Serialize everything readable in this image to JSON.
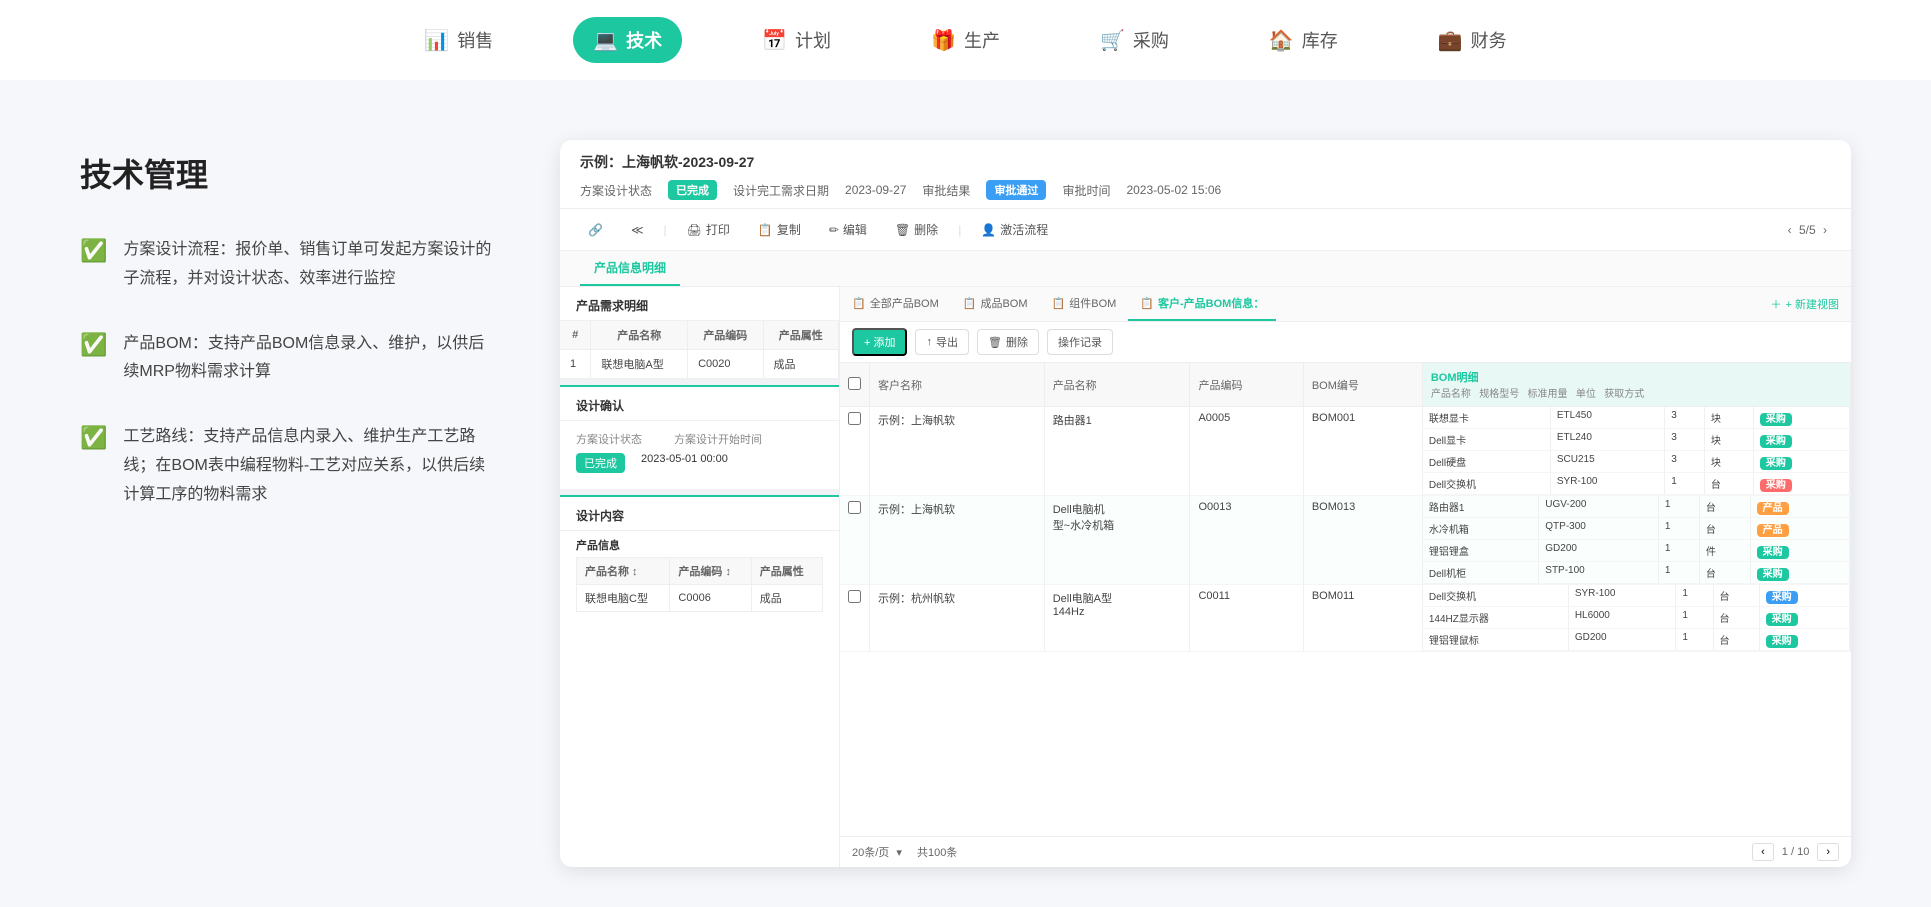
{
  "nav": {
    "items": [
      {
        "id": "sales",
        "label": "销售",
        "icon": "📊",
        "active": false
      },
      {
        "id": "tech",
        "label": "技术",
        "icon": "💻",
        "active": true
      },
      {
        "id": "plan",
        "label": "计划",
        "icon": "📅",
        "active": false
      },
      {
        "id": "produce",
        "label": "生产",
        "icon": "🎁",
        "active": false
      },
      {
        "id": "purchase",
        "label": "采购",
        "icon": "🛒",
        "active": false
      },
      {
        "id": "stock",
        "label": "库存",
        "icon": "🏠",
        "active": false
      },
      {
        "id": "finance",
        "label": "财务",
        "icon": "💼",
        "active": false
      }
    ]
  },
  "left": {
    "title": "技术管理",
    "features": [
      {
        "id": "f1",
        "text": "方案设计流程：报价单、销售订单可发起方案设计的子流程，并对设计状态、效率进行监控"
      },
      {
        "id": "f2",
        "text": "产品BOM：支持产品BOM信息录入、维护，以供后续MRP物料需求计算"
      },
      {
        "id": "f3",
        "text": "工艺路线：支持产品信息内录入、维护生产工艺路线；在BOM表中编程物料-工艺对应关系，以供后续计算工序的物料需求"
      }
    ]
  },
  "demo": {
    "title": "示例：上海帆软-2023-09-27",
    "meta": {
      "status_label": "方案设计状态",
      "status_value": "已完成",
      "design_date_label": "设计完工需求日期",
      "design_date_value": "2023-09-27",
      "approve_result_label": "审批结果",
      "approve_result_value": "审批通过",
      "approve_time_label": "审批时间",
      "approve_time_value": "2023-05-02 15:06"
    },
    "toolbar": {
      "print": "打印",
      "copy": "复制",
      "edit": "编辑",
      "delete": "删除",
      "activate": "激活流程",
      "pagination": "5/5"
    },
    "tabs": {
      "active": "产品信息明细"
    },
    "left_form": {
      "product_demand_title": "产品需求明细",
      "product_demand_cols": [
        "产品名称",
        "产品编码",
        "产品属性"
      ],
      "product_demand_rows": [
        {
          "no": "1",
          "name": "联想电脑A型",
          "code": "C0020",
          "attr": "成品"
        }
      ],
      "design_confirm_title": "设计确认",
      "design_status_label": "方案设计状态",
      "design_start_label": "方案设计开始时间",
      "design_status_value": "已完成",
      "design_start_value": "2023-05-01 00:00",
      "design_content_title": "设计内容",
      "product_info_title": "产品信息",
      "product_info_label": "产品信息",
      "product_table_cols": [
        "产品名称",
        "产品编码",
        "产品属性"
      ],
      "product_table_rows": [
        {
          "name": "联想电脑C型",
          "code": "C0006",
          "attr": "成品"
        }
      ]
    },
    "bom": {
      "tabs": [
        {
          "id": "all",
          "label": "全部产品BOM",
          "icon": "📋",
          "active": false
        },
        {
          "id": "finished",
          "label": "成品BOM",
          "icon": "📋",
          "active": false
        },
        {
          "id": "component",
          "label": "组件BOM",
          "icon": "📋",
          "active": false
        },
        {
          "id": "customer",
          "label": "客户-产品BOM信息：",
          "icon": "📋",
          "active": true
        }
      ],
      "add_tab": "+ 新建视图",
      "toolbar": {
        "add": "+ 添加",
        "export": "↑ 导出",
        "delete": "删除",
        "log": "操作记录"
      },
      "cols": [
        "客户名称",
        "产品名称",
        "产品编码",
        "BOM编号",
        "BOM明细"
      ],
      "bom_detail_cols": [
        "产品名称",
        "规格型号",
        "标准用量",
        "单位",
        "获取方式"
      ],
      "rows": [
        {
          "id": "r1",
          "customer": "示例：上海帆软",
          "product": "路由器1",
          "product_code": "A0005",
          "bom_code": "BOM001",
          "details": [
            {
              "name": "联想显卡",
              "model": "ETL450",
              "qty": "3",
              "unit": "块",
              "method": "采购",
              "method_color": "green"
            },
            {
              "name": "Dell显卡",
              "model": "ETL240",
              "qty": "3",
              "unit": "块",
              "method": "采购",
              "method_color": "green"
            },
            {
              "name": "Dell硬盘",
              "model": "SCU215",
              "qty": "3",
              "unit": "块",
              "method": "采购",
              "method_color": "green"
            },
            {
              "name": "Dell交换机",
              "model": "SYR-100",
              "qty": "1",
              "unit": "台",
              "method": "采购",
              "method_color": "red"
            }
          ]
        },
        {
          "id": "r2",
          "customer": "示例：上海帆软",
          "product": "Dell电脑机型~水冷机箱",
          "product_code": "O0013",
          "bom_code": "BOM013",
          "details": [
            {
              "name": "路由器1",
              "model": "UGV-200",
              "qty": "1",
              "unit": "台",
              "method": "产品",
              "method_color": "orange"
            },
            {
              "name": "水冷机箱",
              "model": "QTP-300",
              "qty": "1",
              "unit": "台",
              "method": "产品",
              "method_color": "orange"
            },
            {
              "name": "锂铝锂盒",
              "model": "GD200",
              "qty": "1",
              "unit": "件",
              "method": "采购",
              "method_color": "green"
            },
            {
              "name": "Dell机柜",
              "model": "STP-100",
              "qty": "1",
              "unit": "台",
              "method": "采购",
              "method_color": "green"
            }
          ]
        },
        {
          "id": "r3",
          "customer": "示例：杭州帆软",
          "product": "Dell电脑A型 144Hz",
          "product_code": "C0011",
          "bom_code": "BOM011",
          "details": [
            {
              "name": "Dell交换机",
              "model": "SYR-100",
              "qty": "1",
              "unit": "台",
              "method": "采购",
              "method_color": "blue"
            },
            {
              "name": "144HZ显示器",
              "model": "HL6000",
              "qty": "1",
              "unit": "台",
              "method": "采购",
              "method_color": "green"
            },
            {
              "name": "锂铝锂鼠标",
              "model": "GD200",
              "qty": "1",
              "unit": "台",
              "method": "采购",
              "method_color": "green"
            }
          ]
        }
      ],
      "footer": {
        "page_size": "20条/页",
        "total": "共100条",
        "page_info": "1 / 10"
      }
    }
  }
}
